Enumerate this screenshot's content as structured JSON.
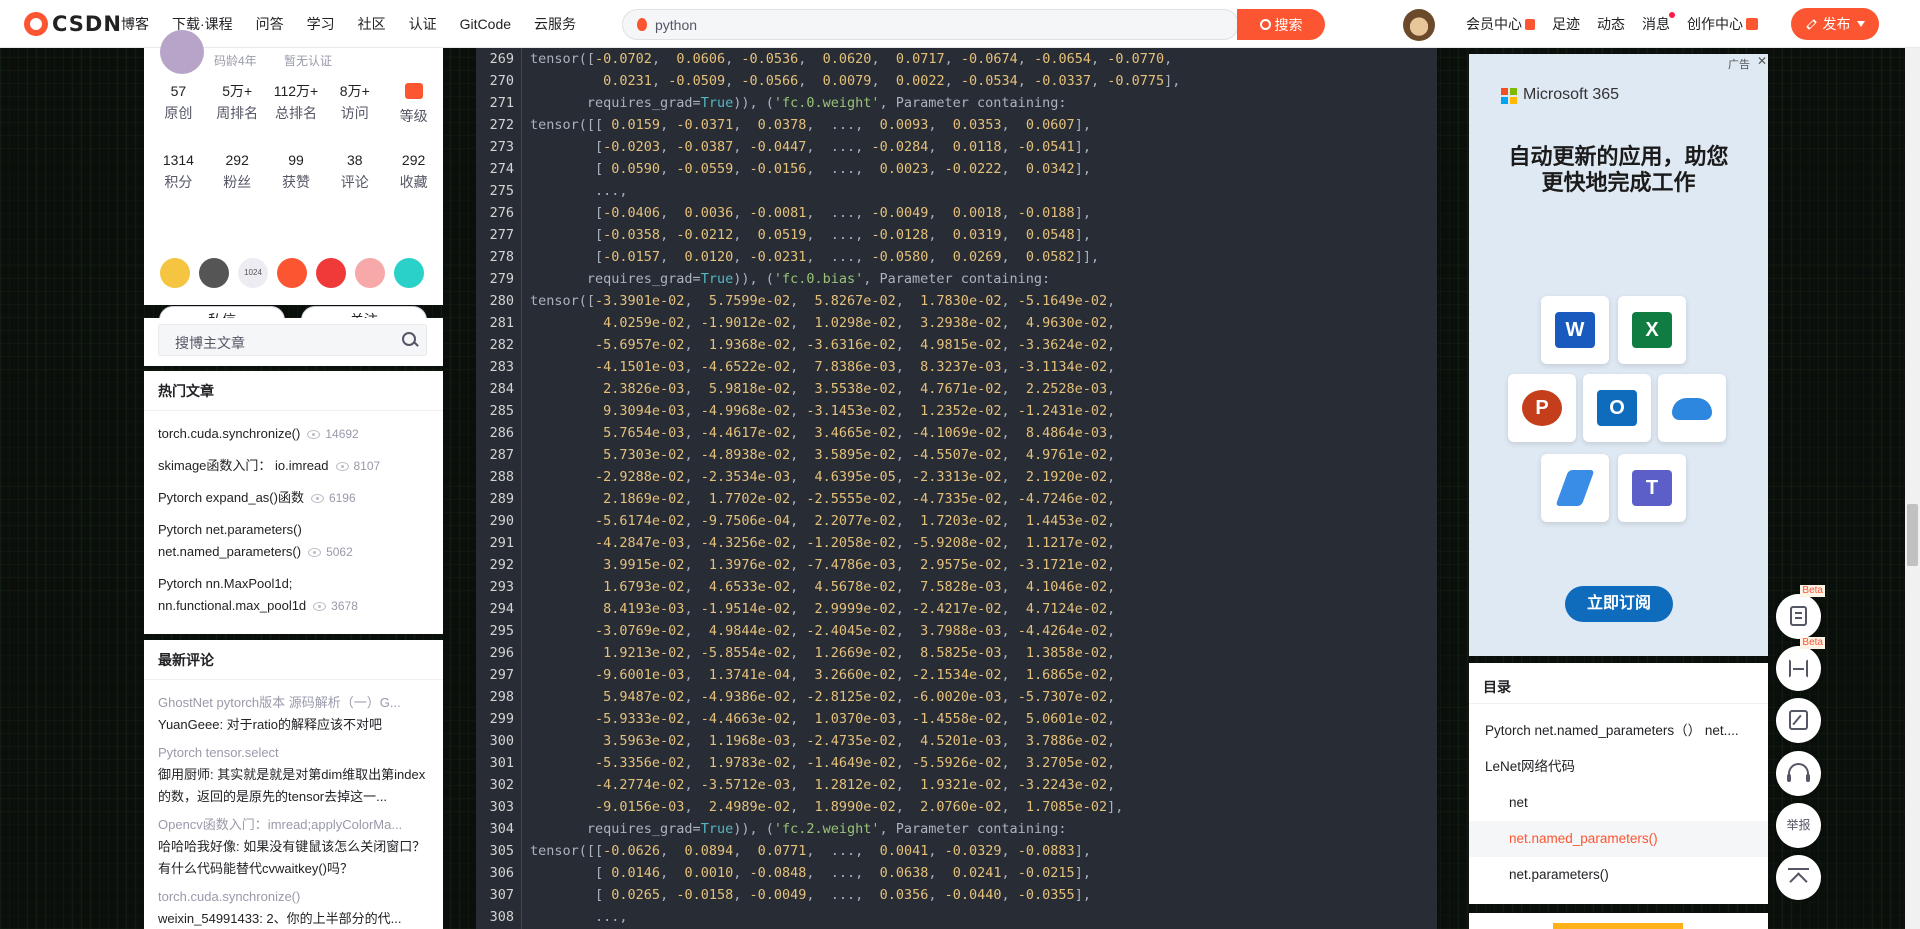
{
  "header": {
    "logo_text": "CSDN",
    "nav": [
      "博客",
      "下载·课程",
      "问答",
      "学习",
      "社区",
      "认证",
      "GitCode",
      "云服务"
    ],
    "search_value": "python",
    "search_button": "搜索",
    "right_links": {
      "vip": "会员中心",
      "footprint": "足迹",
      "dynamics": "动态",
      "messages": "消息",
      "creation": "创作中心"
    },
    "publish_button": "发布"
  },
  "profile": {
    "meta": "码龄4年",
    "cert": "暂无认证",
    "stats_row1": [
      {
        "value": "57",
        "label": "原创"
      },
      {
        "value": "5万+",
        "label": "周排名"
      },
      {
        "value": "112万+",
        "label": "总排名"
      },
      {
        "value": "8万+",
        "label": "访问"
      },
      {
        "value": "",
        "label": "等级"
      }
    ],
    "stats_row2": [
      {
        "value": "1314",
        "label": "积分"
      },
      {
        "value": "292",
        "label": "粉丝"
      },
      {
        "value": "99",
        "label": "获赞"
      },
      {
        "value": "38",
        "label": "评论"
      },
      {
        "value": "292",
        "label": "收藏"
      }
    ],
    "badge_colors": [
      "#f5c542",
      "#555555",
      "#f0f0f0",
      "#fc5531",
      "#f03a3a",
      "#f7a8a8",
      "#2ad1c9"
    ],
    "badge_label_1024": "1024",
    "message_button": "私信",
    "follow_button": "关注"
  },
  "blog_search": {
    "placeholder": "搜博主文章"
  },
  "hot_articles": {
    "title": "热门文章",
    "items": [
      {
        "title": "torch.cuda.synchronize()",
        "views": "14692"
      },
      {
        "title": "skimage函数入门： io.imread",
        "views": "8107"
      },
      {
        "title": "Pytorch expand_as()函数",
        "views": "6196"
      },
      {
        "title": "Pytorch net.parameters() net.named_parameters()",
        "views": "5062"
      },
      {
        "title": "Pytorch nn.MaxPool1d; nn.functional.max_pool1d",
        "views": "3678"
      }
    ]
  },
  "latest_comments": {
    "title": "最新评论",
    "items": [
      {
        "source": "GhostNet pytorch版本 源码解析（一）G...",
        "text": "YuanGeee: 对于ratio的解释应该不对吧"
      },
      {
        "source": "Pytorch tensor.select",
        "text": "御用厨师: 其实就是就是对第dim维取出第index的数，返回的是原先的tensor去掉这一..."
      },
      {
        "source": "Opencv函数入门：imread;applyColorMa...",
        "text": "哈哈哈我好像: 如果没有键鼠该怎么关闭窗口？ 有什么代码能替代cvwaitkey()吗？"
      },
      {
        "source": "torch.cuda.synchronize()",
        "text": "weixin_54991433: 2、你的上半部分的代..."
      }
    ]
  },
  "code": {
    "lines": [
      {
        "n": "269",
        "t": "tensor([-0.0702,  0.0606, -0.0536,  0.0620,  0.0717, -0.0674, -0.0654, -0.0770,"
      },
      {
        "n": "270",
        "t": "         0.0231, -0.0509, -0.0566,  0.0079,  0.0022, -0.0534, -0.0337, -0.0775],"
      },
      {
        "n": "271",
        "t": "       requires_grad=True)), ('fc.0.weight', Parameter containing:"
      },
      {
        "n": "272",
        "t": "tensor([[ 0.0159, -0.0371,  0.0378,  ...,  0.0093,  0.0353,  0.0607],"
      },
      {
        "n": "273",
        "t": "        [-0.0203, -0.0387, -0.0447,  ..., -0.0284,  0.0118, -0.0541],"
      },
      {
        "n": "274",
        "t": "        [ 0.0590, -0.0559, -0.0156,  ...,  0.0023, -0.0222,  0.0342],"
      },
      {
        "n": "275",
        "t": "        ...,"
      },
      {
        "n": "276",
        "t": "        [-0.0406,  0.0036, -0.0081,  ..., -0.0049,  0.0018, -0.0188],"
      },
      {
        "n": "277",
        "t": "        [-0.0358, -0.0212,  0.0519,  ..., -0.0128,  0.0319,  0.0548],"
      },
      {
        "n": "278",
        "t": "        [-0.0157,  0.0120, -0.0231,  ..., -0.0580,  0.0269,  0.0582]],"
      },
      {
        "n": "279",
        "t": "       requires_grad=True)), ('fc.0.bias', Parameter containing:"
      },
      {
        "n": "280",
        "t": "tensor([-3.3901e-02,  5.7599e-02,  5.8267e-02,  1.7830e-02, -5.1649e-02,"
      },
      {
        "n": "281",
        "t": "         4.0259e-02, -1.9012e-02,  1.0298e-02,  3.2938e-02,  4.9630e-02,"
      },
      {
        "n": "282",
        "t": "        -5.6957e-02,  1.9368e-02, -3.6316e-02,  4.9815e-02, -3.3624e-02,"
      },
      {
        "n": "283",
        "t": "        -4.1501e-03, -4.6522e-02,  7.8386e-03,  8.3237e-03, -3.1134e-02,"
      },
      {
        "n": "284",
        "t": "         2.3826e-03,  5.9818e-02,  3.5538e-02,  4.7671e-02,  2.2528e-03,"
      },
      {
        "n": "285",
        "t": "         9.3094e-03, -4.9968e-02, -3.1453e-02,  1.2352e-02, -1.2431e-02,"
      },
      {
        "n": "286",
        "t": "         5.7654e-03, -4.4617e-02,  3.4665e-02, -4.1069e-02,  8.4864e-03,"
      },
      {
        "n": "287",
        "t": "         5.7303e-02, -4.8938e-02,  3.5895e-02, -4.5507e-02,  4.9761e-02,"
      },
      {
        "n": "288",
        "t": "        -2.9288e-02, -2.3534e-03,  4.6395e-05, -2.3313e-02,  2.1920e-02,"
      },
      {
        "n": "289",
        "t": "         2.1869e-02,  1.7702e-02, -2.5555e-02, -4.7335e-02, -4.7246e-02,"
      },
      {
        "n": "290",
        "t": "        -5.6174e-02, -9.7506e-04,  2.2077e-02,  1.7203e-02,  1.4453e-02,"
      },
      {
        "n": "291",
        "t": "        -4.2847e-03, -4.3256e-02, -1.2058e-02, -5.9208e-02,  1.1217e-02,"
      },
      {
        "n": "292",
        "t": "         3.9915e-02,  1.3976e-02, -7.4786e-03,  2.9575e-02, -3.1721e-02,"
      },
      {
        "n": "293",
        "t": "         1.6793e-02,  4.6533e-02,  4.5678e-02,  7.5828e-03,  4.1046e-02,"
      },
      {
        "n": "294",
        "t": "         8.4193e-03, -1.9514e-02,  2.9999e-02, -2.4217e-02,  4.7124e-02,"
      },
      {
        "n": "295",
        "t": "        -3.0769e-02,  4.9844e-02, -2.4045e-02,  3.7988e-03, -4.4264e-02,"
      },
      {
        "n": "296",
        "t": "         1.9213e-02, -5.8554e-02,  1.2669e-02,  8.5825e-03,  1.3858e-02,"
      },
      {
        "n": "297",
        "t": "        -9.6001e-03,  1.3741e-04,  3.2660e-02, -2.1534e-02,  1.6865e-02,"
      },
      {
        "n": "298",
        "t": "         5.9487e-02, -4.9386e-02, -2.8125e-02, -6.0020e-03, -5.7307e-02,"
      },
      {
        "n": "299",
        "t": "        -5.9333e-02, -4.4663e-02,  1.0370e-03, -1.4558e-02,  5.0601e-02,"
      },
      {
        "n": "300",
        "t": "         3.5963e-02,  1.1968e-03, -2.4735e-02,  4.5201e-03,  3.7886e-02,"
      },
      {
        "n": "301",
        "t": "        -5.3356e-02,  1.9783e-02, -1.4649e-02, -5.5926e-02,  3.2705e-02,"
      },
      {
        "n": "302",
        "t": "        -4.2774e-02, -3.5712e-03,  1.2812e-02,  1.9321e-02, -3.2243e-02,"
      },
      {
        "n": "303",
        "t": "        -9.0156e-03,  2.4989e-02,  1.8990e-02,  2.0760e-02,  1.7085e-02],"
      },
      {
        "n": "304",
        "t": "       requires_grad=True)), ('fc.2.weight', Parameter containing:"
      },
      {
        "n": "305",
        "t": "tensor([[-0.0626,  0.0894,  0.0771,  ...,  0.0041, -0.0329, -0.0883],"
      },
      {
        "n": "306",
        "t": "        [ 0.0146,  0.0010, -0.0848,  ...,  0.0638,  0.0241, -0.0215],"
      },
      {
        "n": "307",
        "t": "        [ 0.0265, -0.0158, -0.0049,  ...,  0.0356, -0.0440, -0.0355],"
      },
      {
        "n": "308",
        "t": "        ...,"
      }
    ]
  },
  "ad": {
    "mark": "广告",
    "close": "✕",
    "brand": "Microsoft 365",
    "headline_1": "自动更新的应用，助您",
    "headline_2": "更快地完成工作",
    "cta": "立即订阅",
    "apps": [
      "Word",
      "Excel",
      "PowerPoint",
      "Outlook",
      "OneDrive",
      "Editor",
      "Teams"
    ]
  },
  "toc": {
    "title": "目录",
    "items": [
      {
        "label": "Pytorch net.named_parameters（） net....",
        "level": 1
      },
      {
        "label": "LeNet网络代码",
        "level": 1
      },
      {
        "label": "net",
        "level": 2
      },
      {
        "label": "net.named_parameters()",
        "level": 2,
        "active": true
      },
      {
        "label": "net.parameters()",
        "level": 2
      }
    ]
  },
  "float_tools": {
    "beta": "Beta",
    "report": "举报"
  }
}
